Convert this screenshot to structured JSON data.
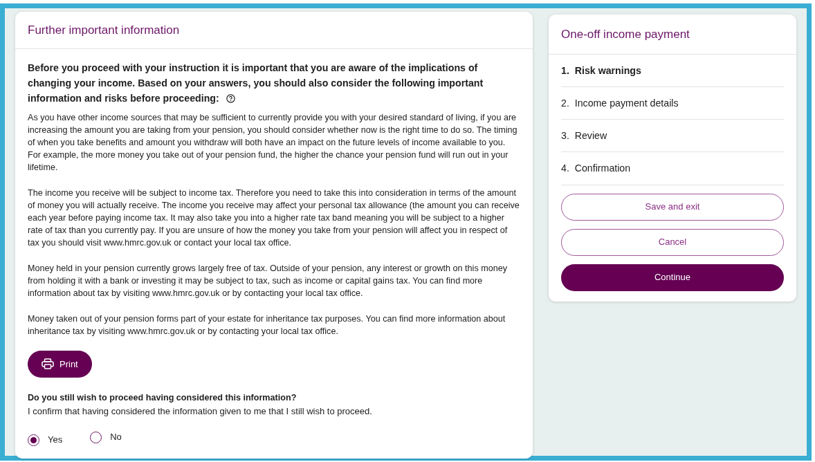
{
  "main": {
    "title": "Further important information",
    "intro": "Before you proceed with your instruction it is important that you are aware of the implications of changing your income. Based on your answers, you should also consider the following important information and risks before proceeding:",
    "paragraphs": [
      "As you have other income sources that may be sufficient to currently provide you with your desired standard of living, if you are increasing the amount you are taking from your pension, you should consider whether now is the right time to do so. The timing of when you take benefits and amount you withdraw will both have an impact on the future levels of income available to you. For example, the more money you take out of your pension fund, the higher the chance your pension fund will run out in your lifetime.",
      "The income you receive will be subject to income tax. Therefore you need to take this into consideration in terms of the amount of money you will actually receive. The income you receive may affect your personal tax allowance (the amount you can receive each year before paying income tax. It may also take you into a higher rate tax band meaning you will be subject to a higher rate of tax than you currently pay. If you are unsure of how the money you take from your pension will affect you in respect of tax you should visit www.hmrc.gov.uk or contact your local tax office.",
      "Money held in your pension currently grows largely free of tax. Outside of your pension, any interest or growth on this money from holding it with a bank or investing it may be subject to tax, such as income or capital gains tax. You can find more information about tax by visiting www.hmrc.gov.uk or by contacting your local tax office.",
      "Money taken out of your pension forms part of your estate for inheritance tax purposes. You can find more information about inheritance tax by visiting www.hmrc.gov.uk or by contacting your local tax office."
    ],
    "print_button": "Print",
    "question": "Do you still wish to proceed having considered this information?",
    "confirmation": "I confirm that having considered the information given to me that I still wish to proceed.",
    "options": [
      {
        "label": "Yes",
        "selected": true
      },
      {
        "label": "No",
        "selected": false
      }
    ]
  },
  "sidebar": {
    "title": "One-off income payment",
    "steps": [
      {
        "number": "1.",
        "label": "Risk warnings",
        "selected": true
      },
      {
        "number": "2.",
        "label": "Income payment details",
        "selected": false
      },
      {
        "number": "3.",
        "label": "Review",
        "selected": false
      },
      {
        "number": "4.",
        "label": "Confirmation",
        "selected": false
      }
    ],
    "buttons": [
      {
        "label": "Save and exit",
        "kind": "outline"
      },
      {
        "label": "Cancel",
        "kind": "outline"
      },
      {
        "label": "Continue",
        "kind": "primary"
      }
    ]
  }
}
